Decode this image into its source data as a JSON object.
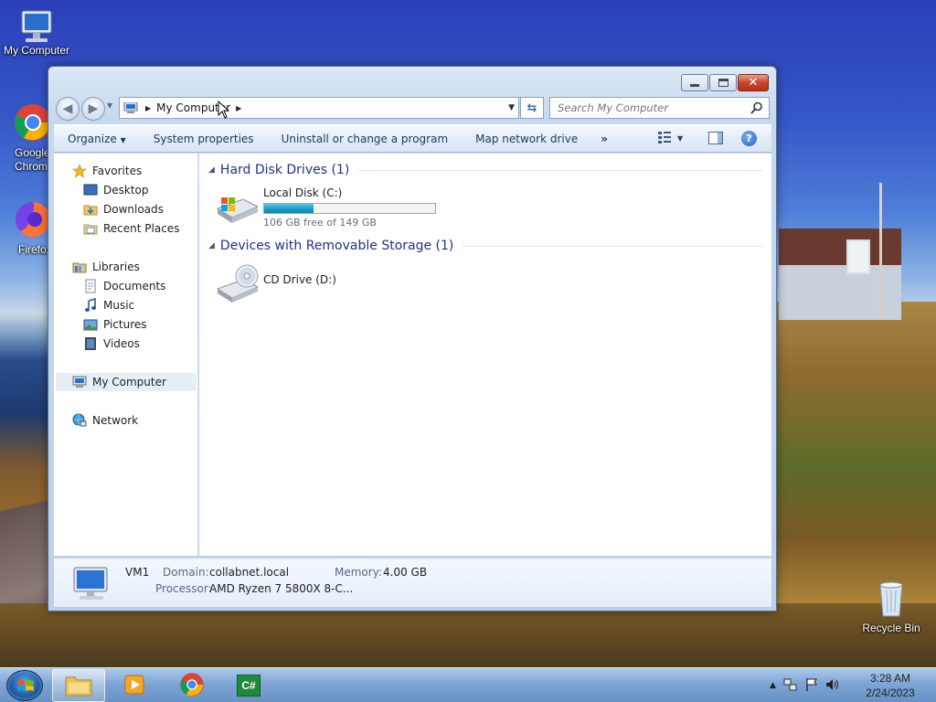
{
  "desktop": {
    "icons": [
      {
        "label": "My Computer"
      },
      {
        "label": "Google Chrome"
      },
      {
        "label": "Firefox"
      },
      {
        "label": "Recycle Bin"
      }
    ]
  },
  "window": {
    "address": {
      "crumb": "My Computer"
    },
    "search": {
      "placeholder": "Search My Computer"
    },
    "toolbar": {
      "organize": "Organize",
      "system_properties": "System properties",
      "uninstall": "Uninstall or change a program",
      "map_drive": "Map network drive",
      "more": "»"
    },
    "nav": {
      "favorites": "Favorites",
      "desktop": "Desktop",
      "downloads": "Downloads",
      "recent": "Recent Places",
      "libraries": "Libraries",
      "documents": "Documents",
      "music": "Music",
      "pictures": "Pictures",
      "videos": "Videos",
      "mycomputer": "My Computer",
      "network": "Network"
    },
    "groups": {
      "hdd": "Hard Disk Drives (1)",
      "removable": "Devices with Removable Storage (1)"
    },
    "drives": {
      "c": {
        "name": "Local Disk (C:)",
        "free": "106 GB free of 149 GB",
        "used_fraction": 0.29
      },
      "d": {
        "name": "CD Drive (D:)"
      }
    },
    "details": {
      "name": "VM1",
      "domain_label": "Domain:",
      "domain": "collabnet.local",
      "memory_label": "Memory:",
      "memory": "4.00 GB",
      "processor_label": "Processor:",
      "processor": "AMD Ryzen 7 5800X 8-C..."
    }
  },
  "taskbar": {
    "time": "3:28 AM",
    "date": "2/24/2023",
    "csharp_label": "C#"
  },
  "colors": {
    "accent": "#1e3287",
    "progress": "#1ea0c8",
    "close": "#c8452c"
  }
}
